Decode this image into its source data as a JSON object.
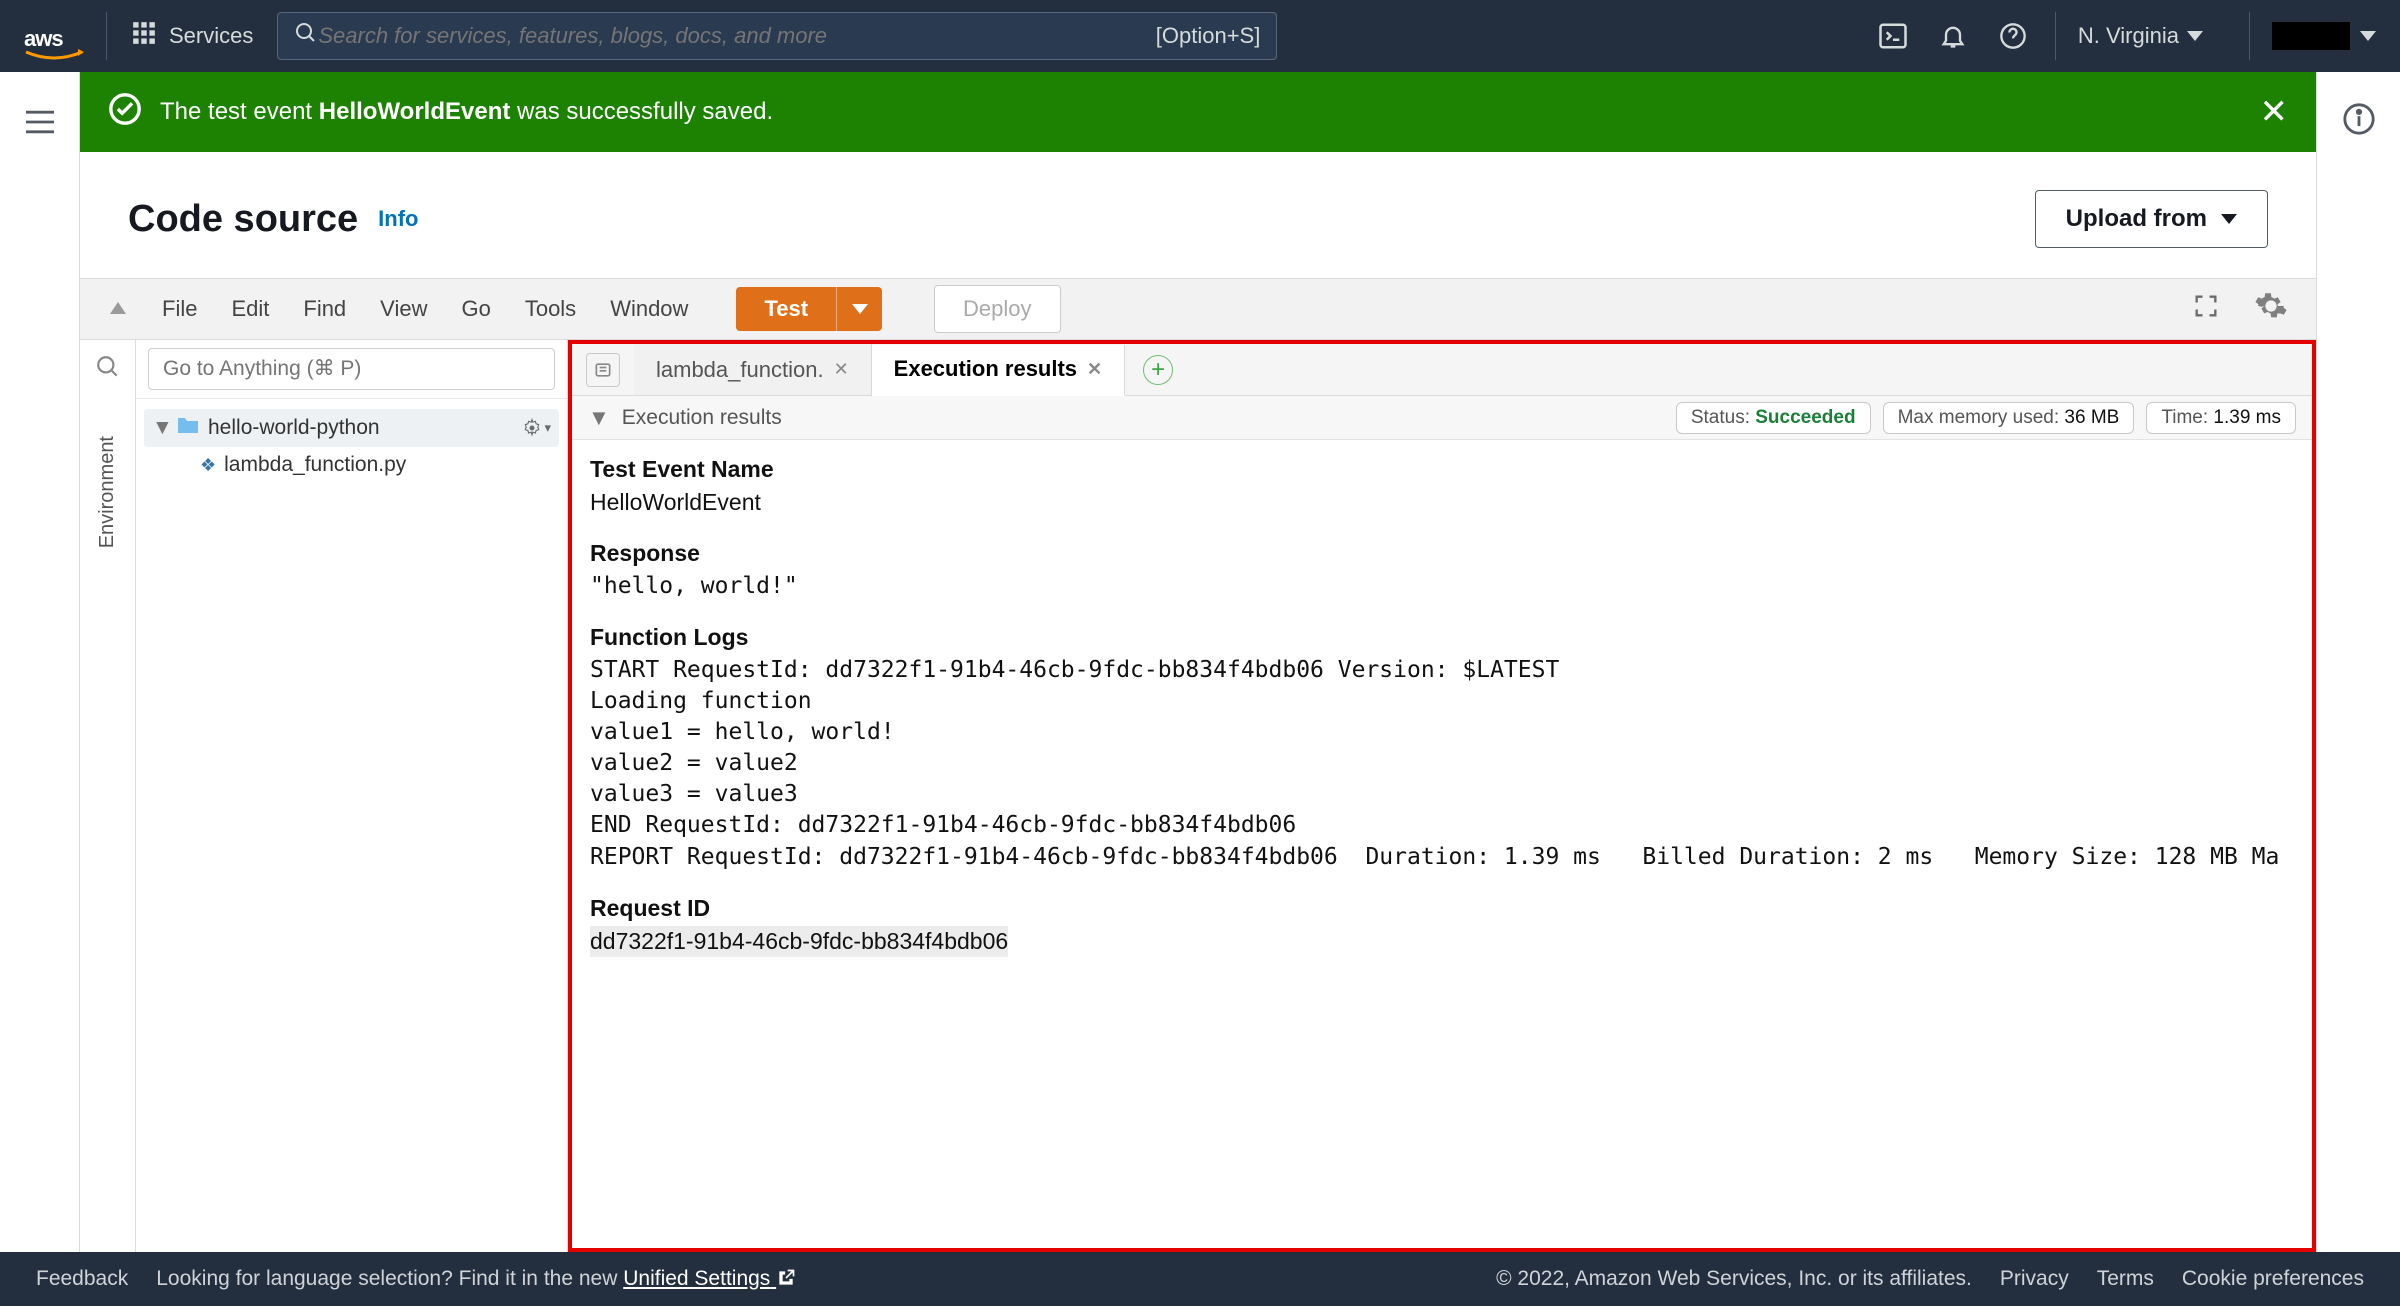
{
  "topnav": {
    "services_label": "Services",
    "search_placeholder": "Search for services, features, blogs, docs, and more",
    "search_shortcut": "[Option+S]",
    "region": "N. Virginia"
  },
  "banner": {
    "prefix": "The test event ",
    "event_name": "HelloWorldEvent",
    "suffix": " was successfully saved."
  },
  "page": {
    "title": "Code source",
    "info": "Info",
    "upload_label": "Upload from"
  },
  "menubar": {
    "items": [
      "File",
      "Edit",
      "Find",
      "View",
      "Go",
      "Tools",
      "Window"
    ],
    "test_label": "Test",
    "deploy_label": "Deploy"
  },
  "explorer": {
    "goto_placeholder": "Go to Anything (⌘ P)",
    "sidebar_label": "Environment",
    "root_name": "hello-world-python",
    "file_name": "lambda_function.py"
  },
  "tabs": {
    "file_tab": "lambda_function.",
    "results_tab": "Execution results"
  },
  "results": {
    "header_label": "Execution results",
    "status_label": "Status: ",
    "status_value": "Succeeded",
    "mem_label": "Max memory used: ",
    "mem_value": "36 MB",
    "time_label": "Time: ",
    "time_value": "1.39 ms",
    "sections": {
      "event_name_h": "Test Event Name",
      "event_name_v": "HelloWorldEvent",
      "response_h": "Response",
      "response_v": "\"hello, world!\"",
      "logs_h": "Function Logs",
      "logs_v": "START RequestId: dd7322f1-91b4-46cb-9fdc-bb834f4bdb06 Version: $LATEST\nLoading function\nvalue1 = hello, world!\nvalue2 = value2\nvalue3 = value3\nEND RequestId: dd7322f1-91b4-46cb-9fdc-bb834f4bdb06\nREPORT RequestId: dd7322f1-91b4-46cb-9fdc-bb834f4bdb06  Duration: 1.39 ms   Billed Duration: 2 ms   Memory Size: 128 MB Ma",
      "reqid_h": "Request ID",
      "reqid_v": "dd7322f1-91b4-46cb-9fdc-bb834f4bdb06"
    }
  },
  "footer": {
    "feedback": "Feedback",
    "lang_prefix": "Looking for language selection? Find it in the new ",
    "lang_link": "Unified Settings",
    "copyright": "© 2022, Amazon Web Services, Inc. or its affiliates.",
    "privacy": "Privacy",
    "terms": "Terms",
    "cookies": "Cookie preferences"
  }
}
